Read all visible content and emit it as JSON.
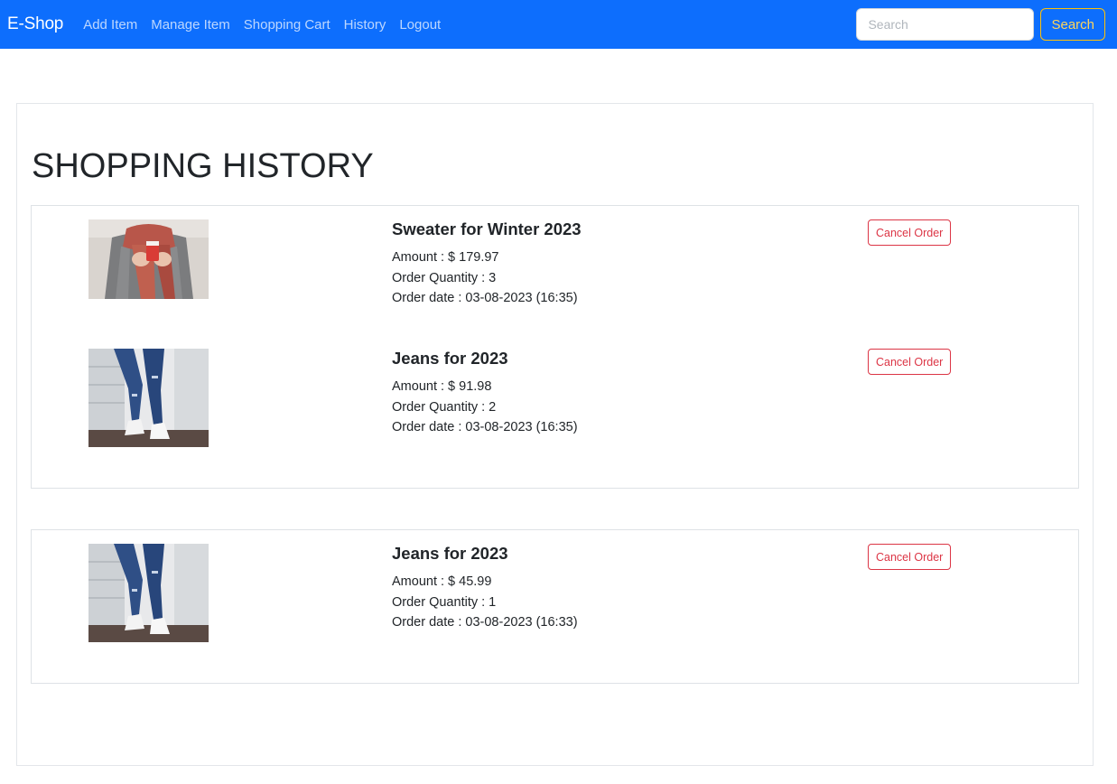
{
  "navbar": {
    "brand": "E-Shop",
    "links": [
      "Add Item",
      "Manage Item",
      "Shopping Cart",
      "History",
      "Logout"
    ],
    "search_placeholder": "Search",
    "search_button": "Search"
  },
  "page": {
    "title": "SHOPPING HISTORY"
  },
  "order_groups": [
    {
      "items": [
        {
          "title": "Sweater for Winter 2023",
          "amount": "Amount : $ 179.97",
          "quantity": "Order Quantity : 3",
          "date": "Order date : 03-08-2023 (16:35)",
          "cancel_label": "Cancel Order",
          "image": "sweater-photo"
        },
        {
          "title": "Jeans for 2023",
          "amount": "Amount : $ 91.98",
          "quantity": "Order Quantity : 2",
          "date": "Order date : 03-08-2023 (16:35)",
          "cancel_label": "Cancel Order",
          "image": "jeans-photo"
        }
      ]
    },
    {
      "items": [
        {
          "title": "Jeans for 2023",
          "amount": "Amount : $ 45.99",
          "quantity": "Order Quantity : 1",
          "date": "Order date : 03-08-2023 (16:33)",
          "cancel_label": "Cancel Order",
          "image": "jeans-photo"
        }
      ]
    }
  ],
  "colors": {
    "navbar": "#0d6efd",
    "search_button_border": "#ffc107",
    "cancel": "#dc3545"
  }
}
